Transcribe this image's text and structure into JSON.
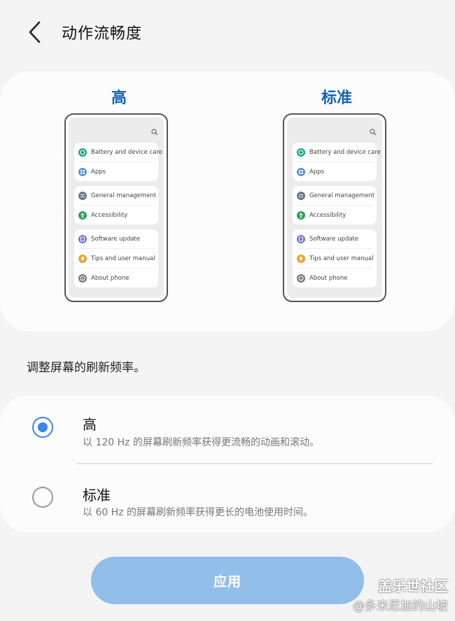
{
  "header": {
    "title": "动作流畅度"
  },
  "preview": {
    "high_label": "高",
    "standard_label": "标准",
    "phone_groups": [
      [
        {
          "label": "Battery and device care",
          "icon": "battery-care-icon",
          "color": "#1aa58a"
        },
        {
          "label": "Apps",
          "icon": "apps-icon",
          "color": "#5b93d6"
        }
      ],
      [
        {
          "label": "General management",
          "icon": "general-management-icon",
          "color": "#6b7788"
        },
        {
          "label": "Accessibility",
          "icon": "accessibility-icon",
          "color": "#2e9e58"
        }
      ],
      [
        {
          "label": "Software update",
          "icon": "software-update-icon",
          "color": "#7b74d6"
        },
        {
          "label": "Tips and user manual",
          "icon": "tips-icon",
          "color": "#f0a030"
        },
        {
          "label": "About phone",
          "icon": "info-icon",
          "color": "#777777"
        }
      ]
    ]
  },
  "description": "调整屏幕的刷新频率。",
  "options": [
    {
      "title": "高",
      "subtitle": "以 120 Hz 的屏幕刷新频率获得更流畅的动画和滚动。",
      "selected": true
    },
    {
      "title": "标准",
      "subtitle": "以 60 Hz 的屏幕刷新频率获得更长的电池使用时间。",
      "selected": false
    }
  ],
  "apply_label": "应用",
  "watermark": {
    "line1": "盖乐世社区",
    "line2": "@多米尼加的山坡"
  },
  "colors": {
    "accent": "#3c85e8",
    "title_blue": "#1663b4",
    "apply_button": "#91bfea"
  }
}
